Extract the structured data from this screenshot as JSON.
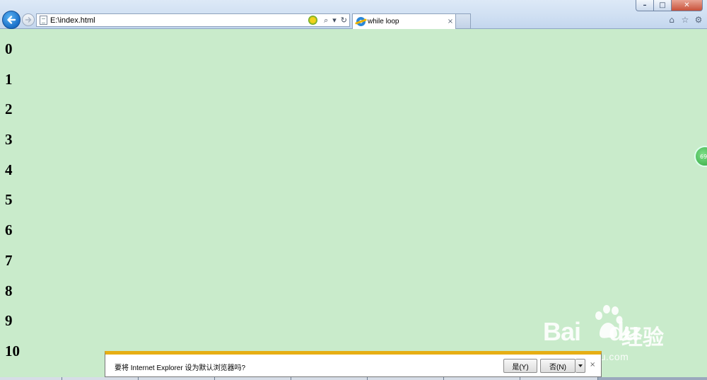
{
  "browser": {
    "address": "E:\\index.html",
    "tab_title": "while loop",
    "tab_close": "×",
    "icons": [
      "back-arrow-icon",
      "forward-arrow-icon",
      "compat-view-icon",
      "search-icon",
      "dropdown-icon",
      "refresh-icon",
      "home-icon",
      "favorites-star-icon",
      "gear-icon"
    ],
    "addr_search": "⌕",
    "addr_drop": "▾",
    "addr_refresh": "↻",
    "home": "⌂",
    "star": "☆",
    "gear": "⚙",
    "win_min": "–",
    "win_max": "□",
    "win_close": "✕"
  },
  "page": {
    "numbers": [
      "0",
      "1",
      "2",
      "3",
      "4",
      "5",
      "6",
      "7",
      "8",
      "9",
      "10"
    ]
  },
  "side_badge": "69",
  "notification": {
    "message": "要将 Internet Explorer 设为默认浏览器吗?",
    "yes_label": "是(Y)",
    "no_label": "否(N)",
    "close": "×",
    "accent_color": "#e6ae14"
  },
  "watermark": {
    "logo": "Bai",
    "logo_suffix": "du",
    "chinese": "经验",
    "url": "jingyan.baidu.com"
  },
  "colors": {
    "page_background": "#c9ebcb",
    "back_button": "#1a6fc7"
  }
}
